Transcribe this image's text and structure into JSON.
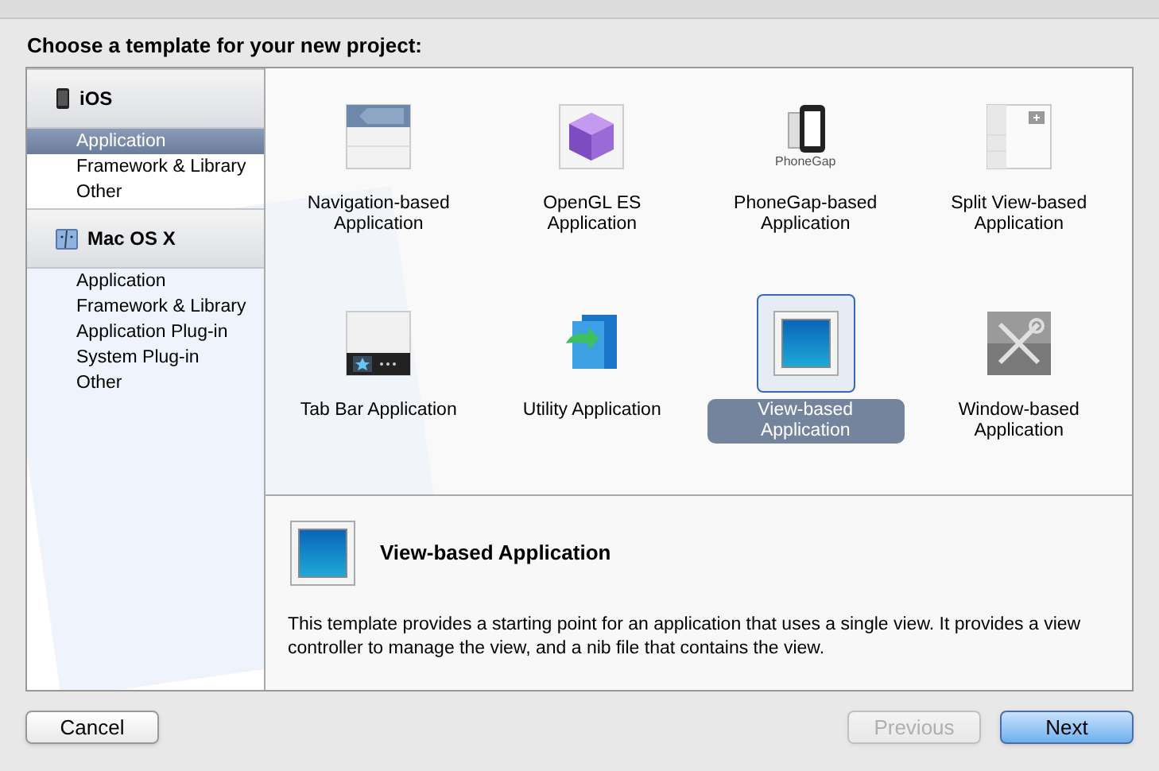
{
  "heading": "Choose a template for your new project:",
  "sidebar": {
    "sections": [
      {
        "title": "iOS",
        "kind": "phone",
        "items": [
          {
            "label": "Application",
            "selected": true
          },
          {
            "label": "Framework & Library",
            "selected": false
          },
          {
            "label": "Other",
            "selected": false
          }
        ]
      },
      {
        "title": "Mac OS X",
        "kind": "finder",
        "items": [
          {
            "label": "Application",
            "selected": false
          },
          {
            "label": "Framework & Library",
            "selected": false
          },
          {
            "label": "Application Plug-in",
            "selected": false
          },
          {
            "label": "System Plug-in",
            "selected": false
          },
          {
            "label": "Other",
            "selected": false
          }
        ]
      }
    ]
  },
  "templates": [
    {
      "label": "Navigation-based Application",
      "kind": "navigation",
      "selected": false
    },
    {
      "label": "OpenGL ES Application",
      "kind": "opengl",
      "selected": false
    },
    {
      "label": "PhoneGap-based Application",
      "kind": "phonegap",
      "icon_text": "PhoneGap",
      "selected": false
    },
    {
      "label": "Split View-based Application",
      "kind": "split",
      "selected": false
    },
    {
      "label": "Tab Bar Application",
      "kind": "tabbar",
      "selected": false
    },
    {
      "label": "Utility Application",
      "kind": "utility",
      "selected": false
    },
    {
      "label": "View-based Application",
      "kind": "view",
      "selected": true
    },
    {
      "label": "Window-based Application",
      "kind": "window",
      "selected": false
    }
  ],
  "detail": {
    "title": "View-based Application",
    "description": "This template provides a starting point for an application that uses a single view. It provides a view controller to manage the view, and a nib file that contains the view."
  },
  "buttons": [
    {
      "label": "Cancel",
      "kind": "normal",
      "disabled": false
    },
    {
      "label": "Previous",
      "kind": "normal",
      "disabled": true
    },
    {
      "label": "Next",
      "kind": "default",
      "disabled": false
    }
  ]
}
